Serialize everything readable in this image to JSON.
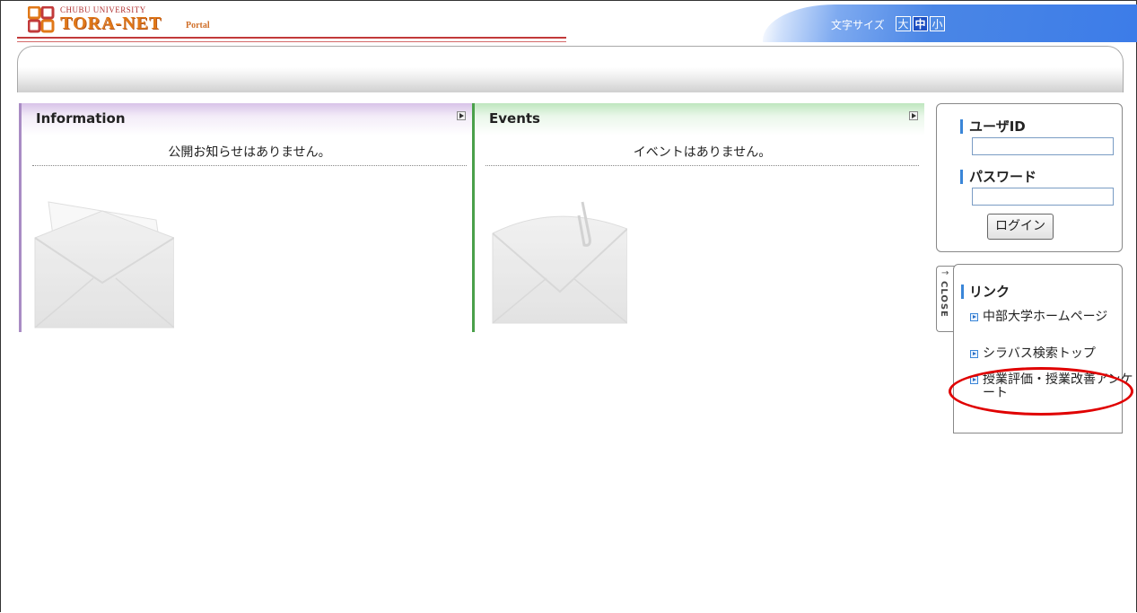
{
  "header": {
    "logo_sup": "CHUBU UNIVERSITY",
    "logo_title": "TORA-NET",
    "logo_sub": "Portal",
    "font_size_label": "文字サイズ",
    "font_size_options": [
      "大",
      "中",
      "小"
    ],
    "font_size_selected": "中"
  },
  "portlets": {
    "information": {
      "title": "Information",
      "message": "公開お知らせはありません。"
    },
    "events": {
      "title": "Events",
      "message": "イベントはありません。"
    }
  },
  "login": {
    "user_id_label": "ユーザID",
    "user_id_value": "",
    "password_label": "パスワード",
    "password_value": "",
    "login_button": "ログイン"
  },
  "links": {
    "close_label": "CLOSE",
    "close_arrow": "→",
    "title": "リンク",
    "items": [
      "中部大学ホームページ",
      "シラバス検索トップ",
      "授業評価・授業改善アンケート"
    ]
  },
  "colors": {
    "accent_blue": "#3c7ce8",
    "info_border": "#a98cc4",
    "events_border": "#4aa04a",
    "highlight_circle": "#e00000"
  }
}
